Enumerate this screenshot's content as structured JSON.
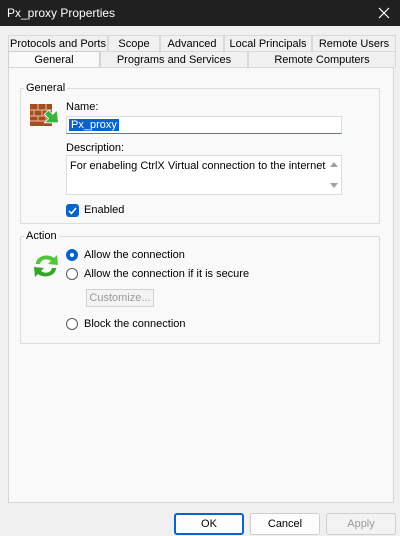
{
  "window": {
    "title": "Px_proxy Properties"
  },
  "tabs_top": [
    "Protocols and Ports",
    "Scope",
    "Advanced",
    "Local Principals",
    "Remote Users"
  ],
  "tabs_bottom": [
    "General",
    "Programs and Services",
    "Remote Computers"
  ],
  "general": {
    "group_label": "General",
    "name_label": "Name:",
    "name_value": "Px_proxy",
    "description_label": "Description:",
    "description_value": "For enabeling CtrlX Virtual connection to the internet",
    "enabled_label": "Enabled"
  },
  "action": {
    "group_label": "Action",
    "allow": "Allow the connection",
    "allow_secure": "Allow the connection if it is secure",
    "customize": "Customize...",
    "block": "Block the connection"
  },
  "footer": {
    "ok": "OK",
    "cancel": "Cancel",
    "apply": "Apply"
  },
  "icons": {
    "close": "close-icon",
    "firewall": "firewall-icon",
    "action": "refresh-arrows-icon",
    "checkbox": "checkmark-icon"
  },
  "colors": {
    "accent": "#0a63c9",
    "titlebar": "#202020"
  }
}
